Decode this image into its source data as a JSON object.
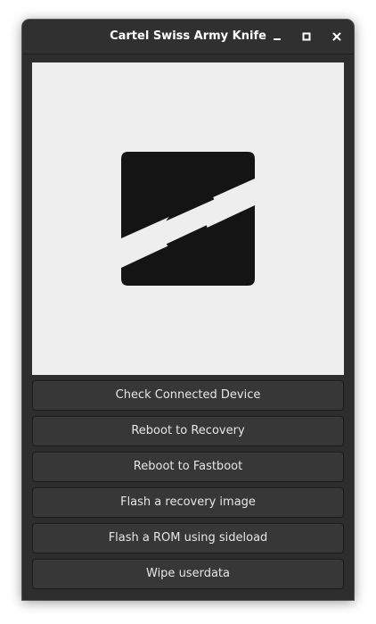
{
  "window": {
    "title": "Cartel Swiss Army Knife",
    "controls": [
      "minimize-icon",
      "maximize-icon",
      "close-icon"
    ]
  },
  "logo": {
    "icon": "cartel-logo",
    "background_color": "#eeeeee",
    "mark_color": "#141414"
  },
  "actions": [
    {
      "label": "Check Connected Device"
    },
    {
      "label": "Reboot to Recovery"
    },
    {
      "label": "Reboot to Fastboot"
    },
    {
      "label": "Flash a recovery image"
    },
    {
      "label": "Flash a ROM using sideload"
    },
    {
      "label": "Wipe userdata"
    }
  ],
  "theme": {
    "window_bg": "#2d2d2d",
    "button_bg": "#373737",
    "text_color": "#e6e6e6"
  }
}
